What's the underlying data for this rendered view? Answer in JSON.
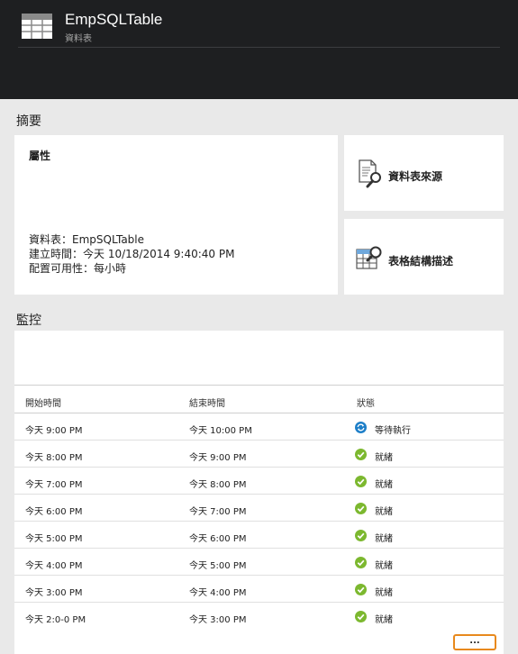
{
  "header": {
    "title": "EmpSQLTable",
    "subtitle": "資料表"
  },
  "summary": {
    "title": "摘要",
    "properties": {
      "label": "屬性",
      "lines": [
        "資料表：EmpSQLTable",
        "建立時間：今天 10/18/2014 9:40:40 PM",
        "配置可用性：每小時"
      ]
    },
    "tiles": [
      {
        "label": "資料表來源",
        "icon": "document-search-icon"
      },
      {
        "label": "表格結構描述",
        "icon": "table-schema-search-icon"
      }
    ]
  },
  "monitor": {
    "title": "監控",
    "columns": [
      "開始時間",
      "結束時間",
      "狀態"
    ],
    "rows": [
      {
        "start": "今天 9:00 PM",
        "end": "今天 10:00 PM",
        "status": "等待執行",
        "status_icon": "waiting-sync-icon"
      },
      {
        "start": "今天 8:00 PM",
        "end": "今天 9:00 PM",
        "status": "就緒",
        "status_icon": "ready-check-icon"
      },
      {
        "start": "今天 7:00 PM",
        "end": "今天 8:00 PM",
        "status": "就緒",
        "status_icon": "ready-check-icon"
      },
      {
        "start": "今天 6:00 PM",
        "end": "今天 7:00 PM",
        "status": "就緒",
        "status_icon": "ready-check-icon"
      },
      {
        "start": "今天 5:00 PM",
        "end": "今天 6:00 PM",
        "status": "就緒",
        "status_icon": "ready-check-icon"
      },
      {
        "start": "今天 4:00 PM",
        "end": "今天 5:00 PM",
        "status": "就緒",
        "status_icon": "ready-check-icon"
      },
      {
        "start": "今天 3:00 PM",
        "end": "今天 4:00 PM",
        "status": "就緒",
        "status_icon": "ready-check-icon"
      },
      {
        "start": "今天 2:0-0 PM",
        "end": "今天 3:00 PM",
        "status": "就緒",
        "status_icon": "ready-check-icon"
      }
    ],
    "more_label": "..."
  },
  "colors": {
    "header_bg": "#1e1f21",
    "ready_green": "#7cb82f",
    "waiting_blue": "#1e7fc8",
    "more_outline": "#e8891d"
  }
}
